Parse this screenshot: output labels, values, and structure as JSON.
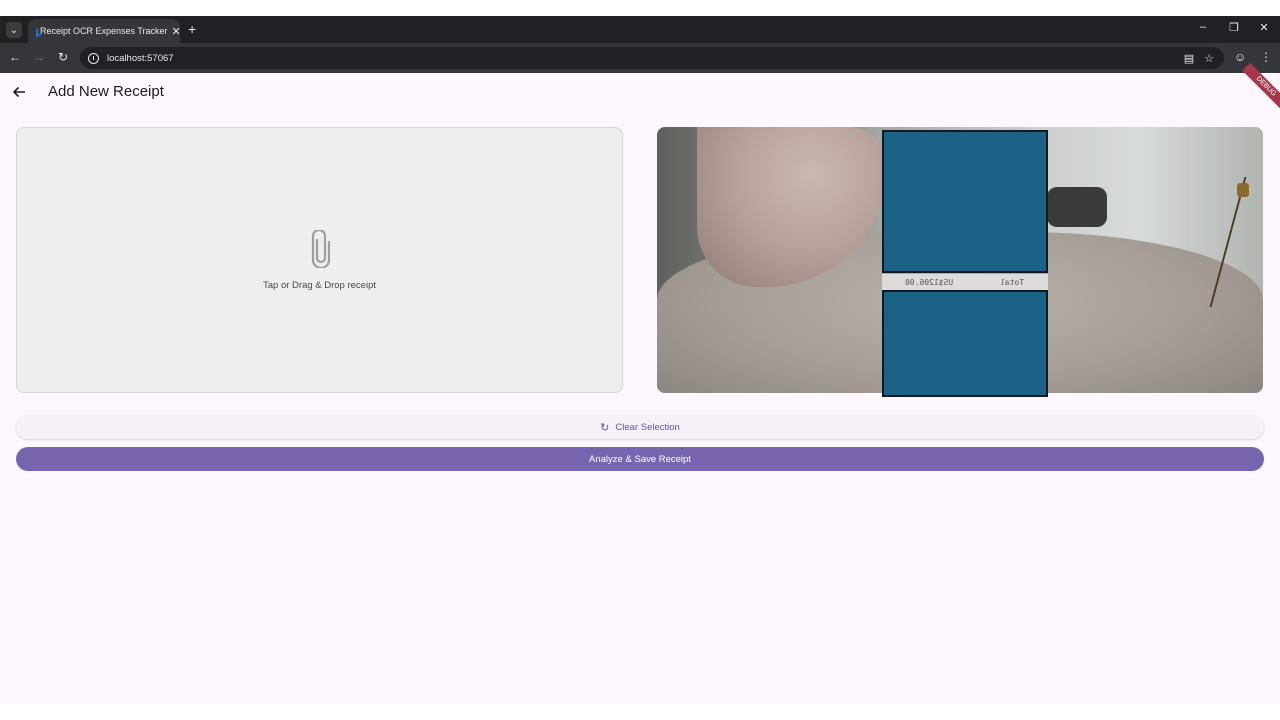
{
  "browser": {
    "tab_title": "Receipt OCR Expenses Tracker",
    "url": "localhost:57067",
    "icons": {
      "tab_list": "chevron-down-icon",
      "close_tab": "close-icon",
      "new_tab": "plus-icon",
      "back": "arrow-left-icon",
      "forward": "arrow-right-icon",
      "reload": "reload-icon",
      "site_info": "info-icon",
      "bookmark": "star-icon",
      "profile": "profile-icon",
      "menu": "kebab-menu-icon"
    }
  },
  "app": {
    "title": "Add New Receipt",
    "debug_banner": "DEBUG",
    "drop_zone": {
      "text": "Tap or Drag & Drop receipt",
      "icon": "paperclip-icon"
    },
    "preview": {
      "receipt_text_left": "US$1206.00",
      "receipt_text_right": "Total"
    },
    "actions": {
      "clear_label": "Clear Selection",
      "analyze_label": "Analyze & Save Receipt"
    },
    "colors": {
      "accent": "#6750a4",
      "primary_button": "#7965af",
      "background": "#fdf7fd",
      "redaction": "#1b6286"
    }
  }
}
